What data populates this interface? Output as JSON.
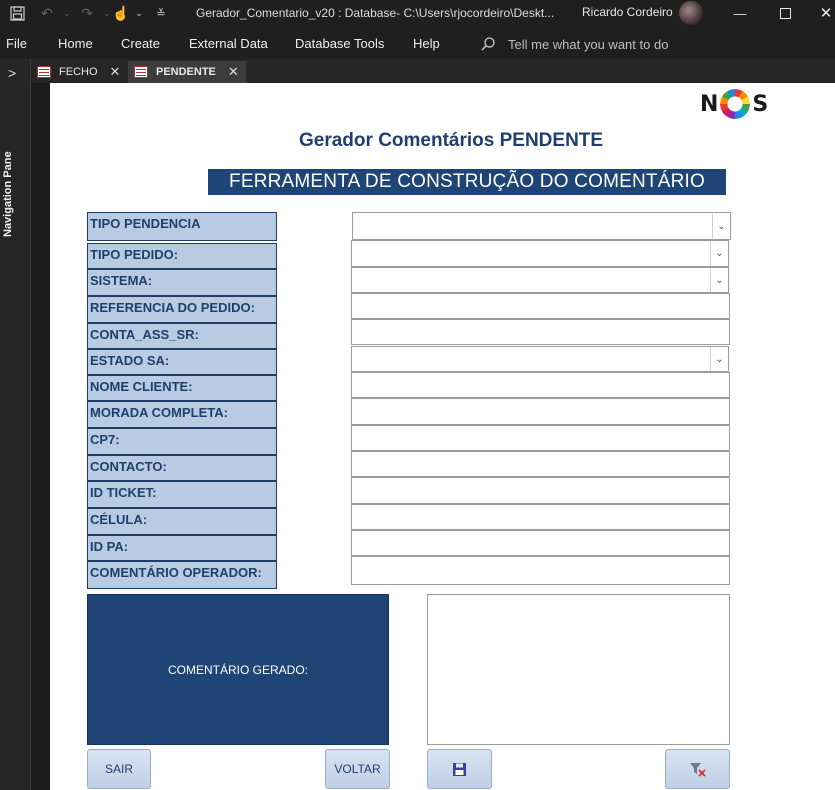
{
  "window": {
    "doc_title": "Gerador_Comentario_v20 : Database- C:\\Users\\rjocordeiro\\Deskt...",
    "user_name": "Ricardo Cordeiro"
  },
  "menu": [
    "File",
    "Home",
    "Create",
    "External Data",
    "Database Tools",
    "Help"
  ],
  "tell_me": "Tell me what you want to do",
  "nav_pane_label": "Navigation Pane",
  "tabs": [
    {
      "label": "FECHO",
      "active": false
    },
    {
      "label": "PENDENTE",
      "active": true
    }
  ],
  "form": {
    "logo_text_left": "N",
    "logo_text_right": "S",
    "title": "Gerador Comentários PENDENTE",
    "banner": "FERRAMENTA DE CONSTRUÇÃO DO COMENTÁRIO",
    "fields": [
      {
        "label": "TIPO PENDENCIA",
        "type": "combo",
        "value": ""
      },
      {
        "label": "TIPO PEDIDO:",
        "type": "combo",
        "value": ""
      },
      {
        "label": "SISTEMA:",
        "type": "combo",
        "value": ""
      },
      {
        "label": "REFERENCIA DO PEDIDO:",
        "type": "text",
        "value": ""
      },
      {
        "label": "CONTA_ASS_SR:",
        "type": "text",
        "value": ""
      },
      {
        "label": "ESTADO SA:",
        "type": "combo",
        "value": ""
      },
      {
        "label": "NOME CLIENTE:",
        "type": "text",
        "value": ""
      },
      {
        "label": "MORADA COMPLETA:",
        "type": "text",
        "value": ""
      },
      {
        "label": "CP7:",
        "type": "text",
        "value": ""
      },
      {
        "label": "CONTACTO:",
        "type": "text",
        "value": ""
      },
      {
        "label": "ID TICKET:",
        "type": "text",
        "value": ""
      },
      {
        "label": "CÉLULA:",
        "type": "text",
        "value": ""
      },
      {
        "label": "ID PA:",
        "type": "text",
        "value": ""
      },
      {
        "label": "COMENTÁRIO OPERADOR:",
        "type": "text",
        "value": ""
      }
    ],
    "generated_label": "COMENTÁRIO GERADO:",
    "generated_text": "",
    "buttons": {
      "sair": "SAIR",
      "voltar": "VOLTAR"
    },
    "icons": {
      "save": "save-icon",
      "clear_filter": "clear-filter-icon"
    },
    "colors": {
      "accent": "#1f4476",
      "label_bg": "#b9cbe3",
      "title_text": "#1f3f6e"
    }
  }
}
